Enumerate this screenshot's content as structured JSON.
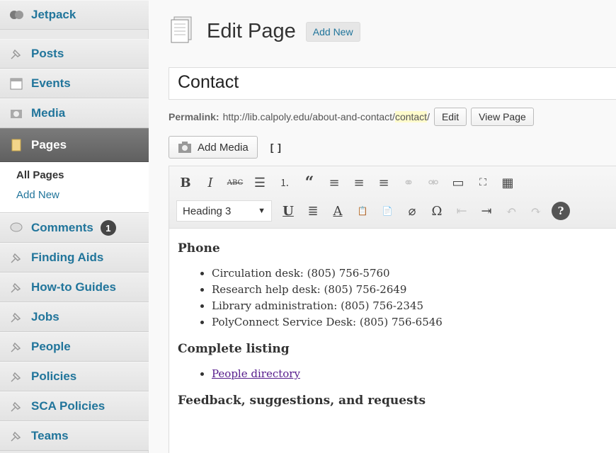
{
  "sidebar": {
    "jetpack": "Jetpack",
    "posts": "Posts",
    "events": "Events",
    "media": "Media",
    "pages": "Pages",
    "pages_sub": {
      "all": "All Pages",
      "add_new": "Add New"
    },
    "comments": "Comments",
    "comments_count": "1",
    "finding_aids": "Finding Aids",
    "howto": "How-to Guides",
    "jobs": "Jobs",
    "people": "People",
    "policies": "Policies",
    "sca_policies": "SCA Policies",
    "teams": "Teams"
  },
  "header": {
    "title": "Edit Page",
    "add_new": "Add New"
  },
  "title_value": "Contact",
  "permalink": {
    "label": "Permalink:",
    "base": "http://lib.calpoly.edu/about-and-contact/",
    "slug": "contact",
    "trail": "/",
    "edit": "Edit",
    "view": "View Page"
  },
  "add_media": "Add Media",
  "toolbar": {
    "format": "Heading 3"
  },
  "content": {
    "h1": "Phone",
    "phones": [
      "Circulation desk: (805) 756-5760",
      "Research help desk: (805) 756-2649",
      "Library administration: (805) 756-2345",
      "PolyConnect Service Desk: (805) 756-6546"
    ],
    "h2": "Complete listing",
    "link": "People directory",
    "h3": "Feedback, suggestions, and requests"
  },
  "colors": {
    "link": "#21759b",
    "active_menu": "#6c6c6c",
    "visited_link": "#551a8b"
  }
}
